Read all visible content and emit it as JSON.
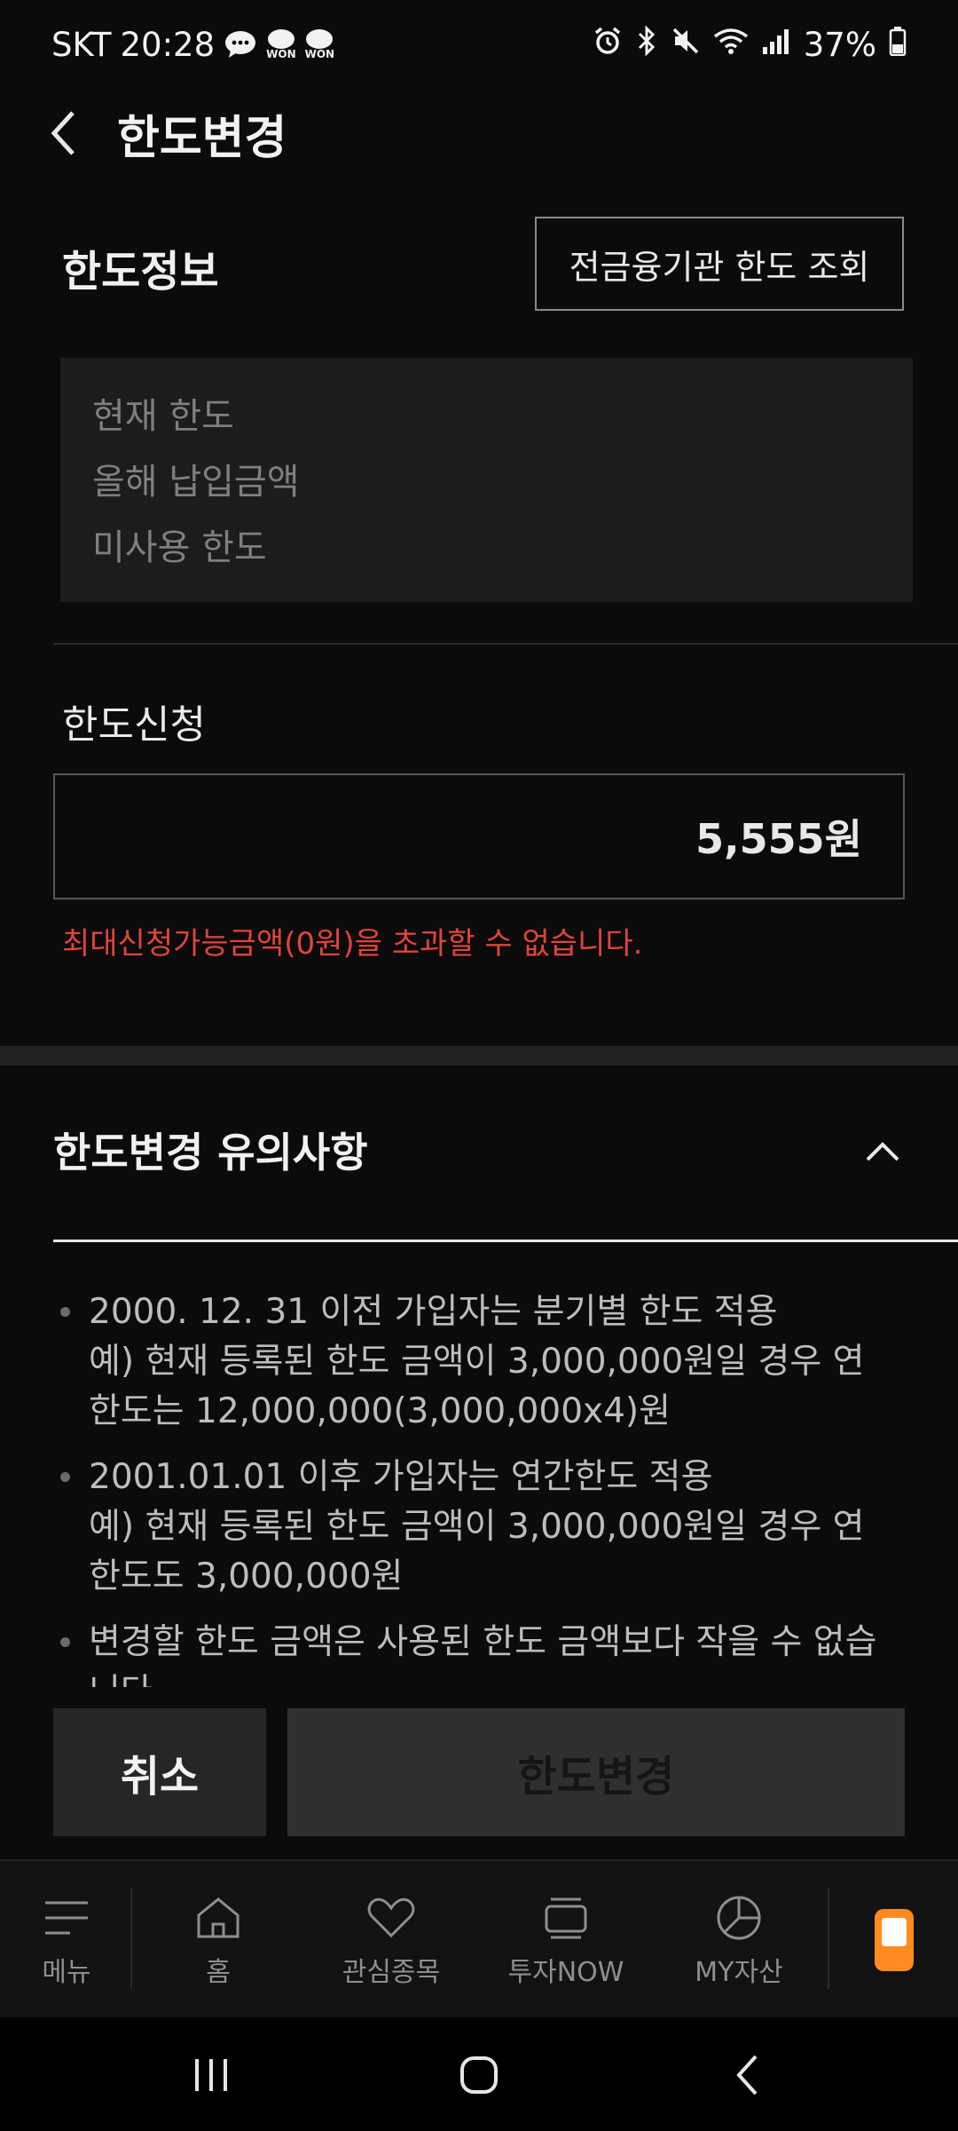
{
  "status_bar": {
    "carrier": "SKT",
    "time": "20:28",
    "won_label_1": "WON",
    "won_label_2": "WON",
    "battery": "37%"
  },
  "header": {
    "title": "한도변경"
  },
  "limit_info": {
    "section_title": "한도정보",
    "all_institutions_button": "전금융기관 한도 조회",
    "rows": [
      "현재 한도",
      "올해 납입금액",
      "미사용 한도"
    ]
  },
  "limit_apply": {
    "label": "한도신청",
    "amount_value": "5,555원",
    "error_message": "최대신청가능금액(0원)을 초과할 수 없습니다."
  },
  "notes": {
    "title": "한도변경 유의사항",
    "items": [
      "2000. 12. 31 이전 가입자는 분기별 한도 적용\n예) 현재 등록된 한도 금액이 3,000,000원일 경우 연 한도는 12,000,000(3,000,000x4)원",
      "2001.01.01 이후 가입자는 연간한도 적용\n예) 현재 등록된 한도 금액이 3,000,000원일 경우 연 한도도 3,000,000원",
      "변경할 한도 금액은 사용된 한도 금액보다 작을 수 없습니다."
    ]
  },
  "actions": {
    "cancel_label": "취소",
    "submit_label": "한도변경"
  },
  "bottom_nav": {
    "items": [
      {
        "label": "메뉴",
        "icon": "menu-icon"
      },
      {
        "label": "홈",
        "icon": "home-icon"
      },
      {
        "label": "관심종목",
        "icon": "heart-icon"
      },
      {
        "label": "투자NOW",
        "icon": "stack-icon"
      },
      {
        "label": "MY자산",
        "icon": "pie-chart-icon"
      }
    ]
  },
  "colors": {
    "background": "#0b0b0b",
    "error": "#e0443a",
    "accent": "#ff8a1f"
  }
}
